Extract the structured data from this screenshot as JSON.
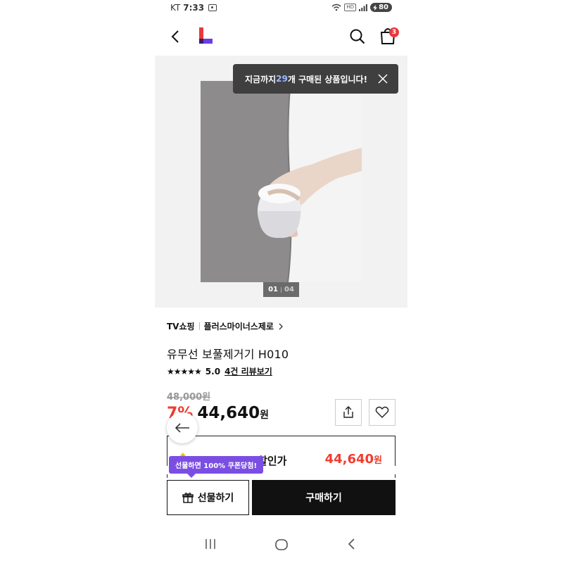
{
  "status_bar": {
    "carrier": "KT",
    "time": "7:33",
    "hd_label": "HD",
    "battery": "80"
  },
  "header": {
    "cart_count": "3"
  },
  "gallery": {
    "current_page": "01",
    "total_pages": "04",
    "toast": {
      "prefix": "지금까지 ",
      "count": "29",
      "suffix": "개 구매된 상품입니다!"
    }
  },
  "product": {
    "channel": "TV쇼핑",
    "brand": "플러스마이너스제로",
    "title": "유무선 보풀제거기 H010",
    "stars": "★★★★★",
    "rating": "5.0",
    "review_link": "4건 리뷰보기",
    "original_price": "48,000원",
    "discount": "7%",
    "price": "44,640",
    "price_unit": "원"
  },
  "coupon": {
    "label": "할인가",
    "price": "44,640",
    "unit": "원"
  },
  "actions": {
    "gift_tooltip": "선물하면 100% 쿠폰당첨!",
    "gift_label": "선물하기",
    "buy_label": "구매하기"
  },
  "colors": {
    "accent_red": "#f03c2e",
    "tooltip_purple": "#7b4ee3",
    "logo_red": "#e8383d",
    "logo_purple": "#6b3ee0"
  }
}
